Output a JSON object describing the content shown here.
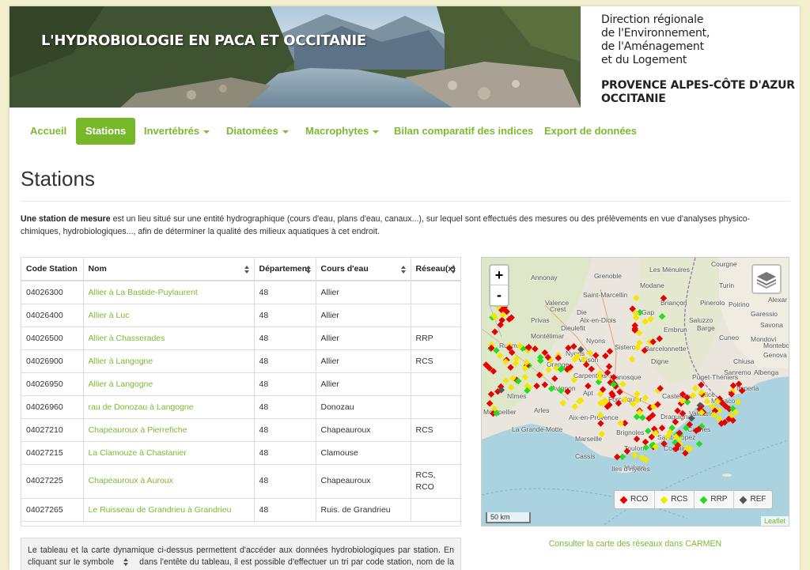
{
  "banner": {
    "title": "L'HYDROBIOLOGIE EN PACA ET OCCITANIE",
    "gov_lines": [
      "Direction régionale",
      "de l'Environnement,",
      "de l'Aménagement",
      "et du Logement"
    ],
    "region_lines": [
      "PROVENCE ALPES-CÔTE D'AZUR",
      "OCCITANIE"
    ]
  },
  "nav": {
    "items": [
      {
        "label": "Accueil"
      },
      {
        "label": "Stations"
      },
      {
        "label": "Invertébrés"
      },
      {
        "label": "Diatomées"
      },
      {
        "label": "Macrophytes"
      },
      {
        "label": "Bilan comparatif des indices"
      },
      {
        "label": "Export de données"
      }
    ]
  },
  "page": {
    "title": "Stations",
    "intro_bold": "Une station de mesure",
    "intro_rest": " est un lieu situé sur une entité hydrographique (cours d'eau, plans d'eau, canaux...), sur lequel sont effectués des mesures ou des prélèvements en vue d'analyses physico-chimiques, hydrobiologiques..., afin de déterminer la qualité des milieux aquatiques à cet endroit."
  },
  "table": {
    "headers": [
      "Code Station",
      "Nom",
      "Département",
      "Cours d'eau",
      "Réseau(x)"
    ],
    "rows": [
      {
        "code": "04026300",
        "nom": "Allier à La Bastide-Puylaurent",
        "dep": "48",
        "cours": "Allier",
        "reseau": ""
      },
      {
        "code": "04026400",
        "nom": "Allier à Luc",
        "dep": "48",
        "cours": "Allier",
        "reseau": ""
      },
      {
        "code": "04026500",
        "nom": "Allier à Chasserades",
        "dep": "48",
        "cours": "Allier",
        "reseau": "RRP"
      },
      {
        "code": "04026900",
        "nom": "Allier à Langogne",
        "dep": "48",
        "cours": "Allier",
        "reseau": "RCS"
      },
      {
        "code": "04026950",
        "nom": "Allier à Langogne",
        "dep": "48",
        "cours": "Allier",
        "reseau": ""
      },
      {
        "code": "04026960",
        "nom": "rau de Donozau à Langogne",
        "dep": "48",
        "cours": "Donozau",
        "reseau": ""
      },
      {
        "code": "04027210",
        "nom": "Chapeauroux à Pierrefiche",
        "dep": "48",
        "cours": "Chapeauroux",
        "reseau": "RCS"
      },
      {
        "code": "04027215",
        "nom": "La Clamouze à Chastanier",
        "dep": "48",
        "cours": "Clamouse",
        "reseau": ""
      },
      {
        "code": "04027225",
        "nom": "Chapeauroux à Auroux",
        "dep": "48",
        "cours": "Chapeauroux",
        "reseau": "RCS,",
        "reseau2": "RCO"
      },
      {
        "code": "04027265",
        "nom": "Le Ruisseau de Grandrieu à Grandrieu",
        "dep": "48",
        "cours": "Ruis. de Grandrieu",
        "reseau": ""
      }
    ]
  },
  "note": {
    "part1": "Le tableau et la carte dynamique ci-dessus permettent d'accéder aux données hydrobiologiques par station. En cliquant sur le symbole",
    "part2": "dans l'entête du tableau, il est possible d'effectuer un tri par code station, nom de la station, département, cours d'eau..."
  },
  "map": {
    "zoom_in": "+",
    "zoom_out": "-",
    "legend": [
      {
        "label": "RCO",
        "color": "#e60000"
      },
      {
        "label": "RCS",
        "color": "#f5e600"
      },
      {
        "label": "RRP",
        "color": "#22dd22"
      },
      {
        "label": "REF",
        "color": "#555555"
      }
    ],
    "scale": "50 km",
    "attribution": "Leaflet",
    "places": [
      "Courgne",
      "Grenoble",
      "Annonay",
      "Les Ménuires",
      "Modane",
      "Turin",
      "Alexar",
      "Saint-Marcellin",
      "Valence",
      "Die",
      "Gap",
      "Pinerolo",
      "Poirino",
      "Briançon",
      "Privas",
      "Aix-en-Diois",
      "Saluzzo",
      "Barge",
      "Montélimar",
      "Digne",
      "Sisteron",
      "Cuneo",
      "Barcelonnette",
      "Mondovì",
      "Manosque",
      "Nîmes",
      "Arles",
      "Avignon",
      "Apt",
      "Aix-en-Provence",
      "Marseille",
      "Toulon",
      "Brignoles",
      "Hyères",
      "Draguignan",
      "Cannes",
      "Nice",
      "Monaco",
      "Imperia",
      "Genova",
      "Sanremo",
      "La Grande-Motte",
      "Cassis",
      "Cogolin",
      "Iles d'Hyères",
      "Montpellier",
      "Ruoms",
      "Orange",
      "Carpentras",
      "Embrun",
      "Vaison",
      "Savona",
      "Albenga",
      "Crest",
      "Dieulefit",
      "Nyons",
      "Forcalquier",
      "Castellane",
      "Puget-Théniers",
      "Nyons",
      "Saint-Tropez",
      "Monteboso",
      "Garessio",
      "Chiusa",
      "Vallauris"
    ]
  },
  "links": {
    "carmen": "Consulter la carte des réseaux dans CARMEN"
  }
}
